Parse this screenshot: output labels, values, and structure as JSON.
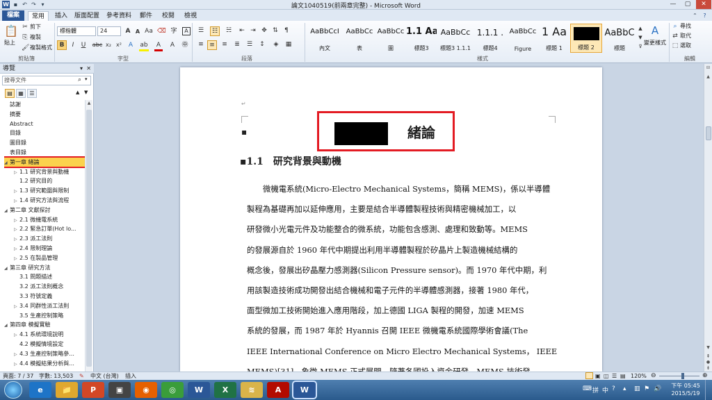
{
  "window": {
    "title": "論文1040519(前兩章完整) - Microsoft Word",
    "controls": [
      "—",
      "▢",
      "✕"
    ]
  },
  "tabs": [
    "檔案",
    "常用",
    "插入",
    "版面配置",
    "參考資料",
    "郵件",
    "校閱",
    "檢視"
  ],
  "ribbon": {
    "clipboard": {
      "paste_label": "貼上",
      "cut_label": "剪下",
      "copy_label": "複製",
      "format_painter_label": "複製格式",
      "group_label": "剪貼簿"
    },
    "font": {
      "font_name": "標楷體",
      "font_size": "24",
      "bold": "B",
      "italic": "I",
      "underline": "U",
      "strike": "abc",
      "subscript": "x₂",
      "superscript": "x²",
      "group_label": "字型"
    },
    "paragraph": {
      "group_label": "段落"
    },
    "styles": {
      "items": [
        {
          "preview": "AaBbCcI",
          "name": "內文"
        },
        {
          "preview": "AaBbCc",
          "name": "表"
        },
        {
          "preview": "AaBbCc",
          "name": "圖"
        },
        {
          "preview": "1.1 Aa",
          "name": "標題3"
        },
        {
          "preview": "AaBbCc",
          "name": "標題3 1.1.1"
        },
        {
          "preview": "1.1.1 .",
          "name": "標題4"
        },
        {
          "preview": "AaBbCc",
          "name": "Figure"
        },
        {
          "preview": "1 Aa",
          "name": "標題 1"
        },
        {
          "preview": "",
          "name": "標題 2"
        },
        {
          "preview": "AaBbC",
          "name": "標題"
        }
      ],
      "change_styles_label": "變更樣式",
      "group_label": "樣式"
    },
    "editing": {
      "find_label": "尋找",
      "replace_label": "取代",
      "select_label": "選取",
      "group_label": "編輯"
    }
  },
  "nav": {
    "title": "導覽",
    "search_placeholder": "搜尋文件",
    "items": [
      {
        "label": "誌謝",
        "level": 0,
        "toggle": ""
      },
      {
        "label": "摘要",
        "level": 0,
        "toggle": ""
      },
      {
        "label": "Abstract",
        "level": 0,
        "toggle": ""
      },
      {
        "label": "目錄",
        "level": 0,
        "toggle": ""
      },
      {
        "label": "圖目錄",
        "level": 0,
        "toggle": ""
      },
      {
        "label": "表目錄",
        "level": 0,
        "toggle": ""
      },
      {
        "label": "第一章 緒論",
        "level": 0,
        "toggle": "◢",
        "selected": true
      },
      {
        "label": "1.1 研究背景與動機",
        "level": 1,
        "toggle": "▷"
      },
      {
        "label": "1.2 研究目的",
        "level": 1,
        "toggle": ""
      },
      {
        "label": "1.3 研究範圍與限制",
        "level": 1,
        "toggle": "▷"
      },
      {
        "label": "1.4 研究方法與流程",
        "level": 1,
        "toggle": "▷"
      },
      {
        "label": "第二章 文獻探討",
        "level": 0,
        "toggle": "◢"
      },
      {
        "label": "2.1 微機電系統",
        "level": 1,
        "toggle": "▷"
      },
      {
        "label": "2.2 緊急訂單(Hot lo...",
        "level": 1,
        "toggle": "▷"
      },
      {
        "label": "2.3 派工法則",
        "level": 1,
        "toggle": "▷"
      },
      {
        "label": "2.4 限制理論",
        "level": 1,
        "toggle": "▷"
      },
      {
        "label": "2.5 在製品管理",
        "level": 1,
        "toggle": "▷"
      },
      {
        "label": "第三章 研究方法",
        "level": 0,
        "toggle": "◢"
      },
      {
        "label": "3.1 問題描述",
        "level": 1,
        "toggle": ""
      },
      {
        "label": "3.2 派工法則概念",
        "level": 1,
        "toggle": ""
      },
      {
        "label": "3.3 符號定義",
        "level": 1,
        "toggle": ""
      },
      {
        "label": "3.4 同群性派工法則",
        "level": 1,
        "toggle": "▷"
      },
      {
        "label": "3.5 生產控制策略",
        "level": 1,
        "toggle": ""
      },
      {
        "label": "第四章 模擬實驗",
        "level": 0,
        "toggle": "◢"
      },
      {
        "label": "4.1 系統環境說明",
        "level": 1,
        "toggle": "▷"
      },
      {
        "label": "4.2 模擬情境設定",
        "level": 1,
        "toggle": ""
      },
      {
        "label": "4.3 生產控制策略參...",
        "level": 1,
        "toggle": "▷"
      },
      {
        "label": "4.4 模擬結果分析與...",
        "level": 1,
        "toggle": "▷"
      }
    ]
  },
  "document": {
    "chapter_title": "緒論",
    "section_heading": "1.1　研究背景與動機",
    "paragraph_lines": [
      "微機電系統(Micro-Electro Mechanical Systems，簡稱 MEMS)，係以半導體",
      "製程為基礎再加以延伸應用，主要是結合半導體製程技術與精密機械加工，以",
      "研發微小光電元件及功能整合的微系統，功能包含感測、處理和致動等。MEMS",
      "的發展源自於 1960 年代中期提出利用半導體製程於矽晶片上製造機械結構的",
      "概念後，發展出矽晶壓力感測器(Silicon Pressure sensor)。而 1970 年代中期，利",
      "用該製造技術成功開發出結合機械和電子元件的半導體感測器，接著 1980 年代，",
      "面型微加工技術開始進入應用階段，加上德國 LIGA 製程的開發，加速 MEMS",
      "系統的發展，而 1987 年於 Hyannis 召開 IEEE 微機電系統國際學術會議(The",
      "IEEE International Conference on Micro Electro Mechanical Systems， IEEE",
      "MEMS)[31]，象徵 MEMS 正式展開。隨著各國投入資金研發，MEMS 技術發"
    ]
  },
  "status": {
    "page": "頁面: 7 / 37",
    "words": "字數: 13,503",
    "language": "中文 (台灣)",
    "mode": "插入",
    "zoom": "120%",
    "zoom_fraction": 0.6
  },
  "taskbar": {
    "apps": [
      "e",
      "📁",
      "P",
      "▣",
      "◉",
      "◎",
      "W",
      "X",
      "≋",
      "A",
      "W"
    ],
    "time": "下午 05:45",
    "date": "2015/5/19"
  },
  "colors": {
    "file_tab": "#2b5797",
    "highlight_box": "#e31b23",
    "redacted": "#000000",
    "nav_selected": "#fbd24d"
  }
}
